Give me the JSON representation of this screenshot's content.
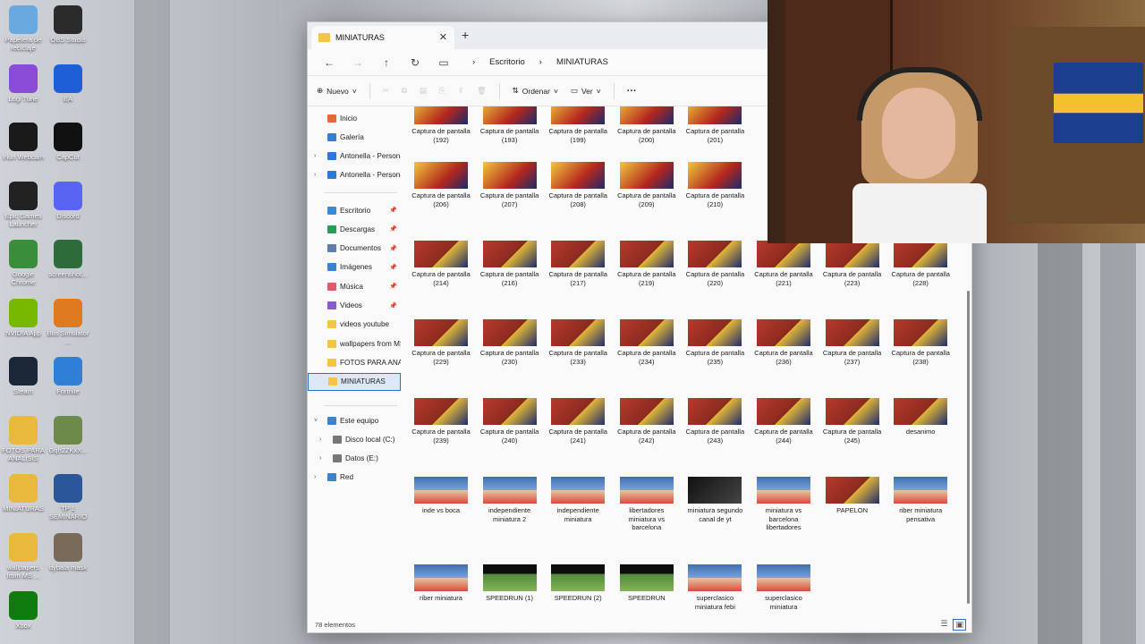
{
  "desktop": {
    "icons": [
      {
        "label": "Papelera de reciclaje",
        "icon": "recycle-bin-icon",
        "color": "#6aa9e0"
      },
      {
        "label": "OBS Studio",
        "icon": "obs-icon",
        "color": "#2b2b2b"
      },
      {
        "label": "Logi Tune",
        "icon": "logi-tune-icon",
        "color": "#8a4bd6"
      },
      {
        "label": "EA",
        "icon": "ea-icon",
        "color": "#1d5fd6"
      },
      {
        "label": "Iriun Webcam",
        "icon": "webcam-icon",
        "color": "#1a1a1a"
      },
      {
        "label": "CapCut",
        "icon": "capcut-icon",
        "color": "#111111"
      },
      {
        "label": "Epic Games Launcher",
        "icon": "epic-games-icon",
        "color": "#222222"
      },
      {
        "label": "Discord",
        "icon": "discord-icon",
        "color": "#5865f2"
      },
      {
        "label": "Google Chrome",
        "icon": "chrome-icon",
        "color": "#3a8e3a"
      },
      {
        "label": "screenshot...",
        "icon": "image-file-icon",
        "color": "#2e6b3a"
      },
      {
        "label": "NVIDIA App",
        "icon": "nvidia-icon",
        "color": "#76b900"
      },
      {
        "label": "Bus Simulator ...",
        "icon": "bus-sim-icon",
        "color": "#e07a1f"
      },
      {
        "label": "Steam",
        "icon": "steam-icon",
        "color": "#1b2838"
      },
      {
        "label": "Fortnite",
        "icon": "fortnite-icon",
        "color": "#2f7fd6"
      },
      {
        "label": "FOTOS PARA ANALISIS",
        "icon": "folder-icon",
        "color": "#e8b93c"
      },
      {
        "label": "Gqh2ZKxX...",
        "icon": "image-file-icon",
        "color": "#6e8a4a"
      },
      {
        "label": "MINIATURAS",
        "icon": "folder-icon",
        "color": "#e8b93c"
      },
      {
        "label": "TP 1 SEMINARIO",
        "icon": "word-doc-icon",
        "color": "#2b579a"
      },
      {
        "label": "wallpapers from MS ...",
        "icon": "folder-icon",
        "color": "#e8b93c"
      },
      {
        "label": "dybala mask",
        "icon": "image-file-icon",
        "color": "#7a6a5a"
      },
      {
        "label": "Xbox",
        "icon": "xbox-icon",
        "color": "#107c10"
      }
    ]
  },
  "explorer": {
    "tab_title": "MINIATURAS",
    "new_tab": "+",
    "close": "✕",
    "breadcrumb": [
      "Escritorio",
      "MINIATURAS"
    ],
    "toolbar": {
      "new_label": "Nuevo",
      "sort_label": "Ordenar",
      "view_label": "Ver",
      "more": "···"
    },
    "nav": {
      "top": [
        {
          "label": "Inicio",
          "icon": "home-icon"
        },
        {
          "label": "Galería",
          "icon": "gallery-icon"
        },
        {
          "label": "Antonella - Personal",
          "icon": "onedrive-icon"
        },
        {
          "label": "Antonella - Personal",
          "icon": "onedrive-icon"
        }
      ],
      "quick": [
        {
          "label": "Escritorio",
          "icon": "desktop-icon"
        },
        {
          "label": "Descargas",
          "icon": "download-icon"
        },
        {
          "label": "Documentos",
          "icon": "documents-icon"
        },
        {
          "label": "Imágenes",
          "icon": "pictures-icon"
        },
        {
          "label": "Música",
          "icon": "music-icon"
        },
        {
          "label": "Videos",
          "icon": "videos-icon"
        },
        {
          "label": "videos youtube",
          "icon": "folder-icon"
        },
        {
          "label": "wallpapers from MS",
          "icon": "folder-icon"
        },
        {
          "label": "FOTOS PARA ANALISIS",
          "icon": "folder-icon"
        },
        {
          "label": "MINIATURAS",
          "icon": "folder-icon"
        }
      ],
      "pc": [
        {
          "label": "Este equipo",
          "icon": "computer-icon"
        },
        {
          "label": "Disco local (C:)",
          "icon": "drive-icon"
        },
        {
          "label": "Datos (E:)",
          "icon": "drive-icon"
        },
        {
          "label": "Red",
          "icon": "network-icon"
        }
      ]
    },
    "files": [
      [
        "Captura de pantalla (192)",
        "Captura de pantalla (193)",
        "Captura de pantalla (199)",
        "Captura de pantalla (200)",
        "Captura de pantalla (201)"
      ],
      [
        "Captura de pantalla (206)",
        "Captura de pantalla (207)",
        "Captura de pantalla (208)",
        "Captura de pantalla (209)",
        "Captura de pantalla (210)"
      ],
      [
        "Captura de pantalla (214)",
        "Captura de pantalla (216)",
        "Captura de pantalla (217)",
        "Captura de pantalla (219)",
        "Captura de pantalla (220)",
        "Captura de pantalla (221)",
        "Captura de pantalla (223)",
        "Captura de pantalla (228)"
      ],
      [
        "Captura de pantalla (229)",
        "Captura de pantalla (230)",
        "Captura de pantalla (233)",
        "Captura de pantalla (234)",
        "Captura de pantalla (235)",
        "Captura de pantalla (236)",
        "Captura de pantalla (237)",
        "Captura de pantalla (238)"
      ],
      [
        "Captura de pantalla (239)",
        "Captura de pantalla (240)",
        "Captura de pantalla (241)",
        "Captura de pantalla (242)",
        "Captura de pantalla (243)",
        "Captura de pantalla (244)",
        "Captura de pantalla (245)",
        "desanimo"
      ],
      [
        "inde vs boca",
        "independiente miniatura 2",
        "independiente miniatura",
        "libertadores miniatura vs barcelona",
        "miniatura segundo canal de yt",
        "miniatura vs barcelona libertadores",
        "PAPELON",
        "riber miniatura pensativa"
      ],
      [
        "riber miniatura",
        "SPEEDRUN (1)",
        "SPEEDRUN (2)",
        "SPEEDRUN",
        "superclasico miniatura febi",
        "superclasico miniatura"
      ]
    ],
    "status": "78 elementos"
  }
}
